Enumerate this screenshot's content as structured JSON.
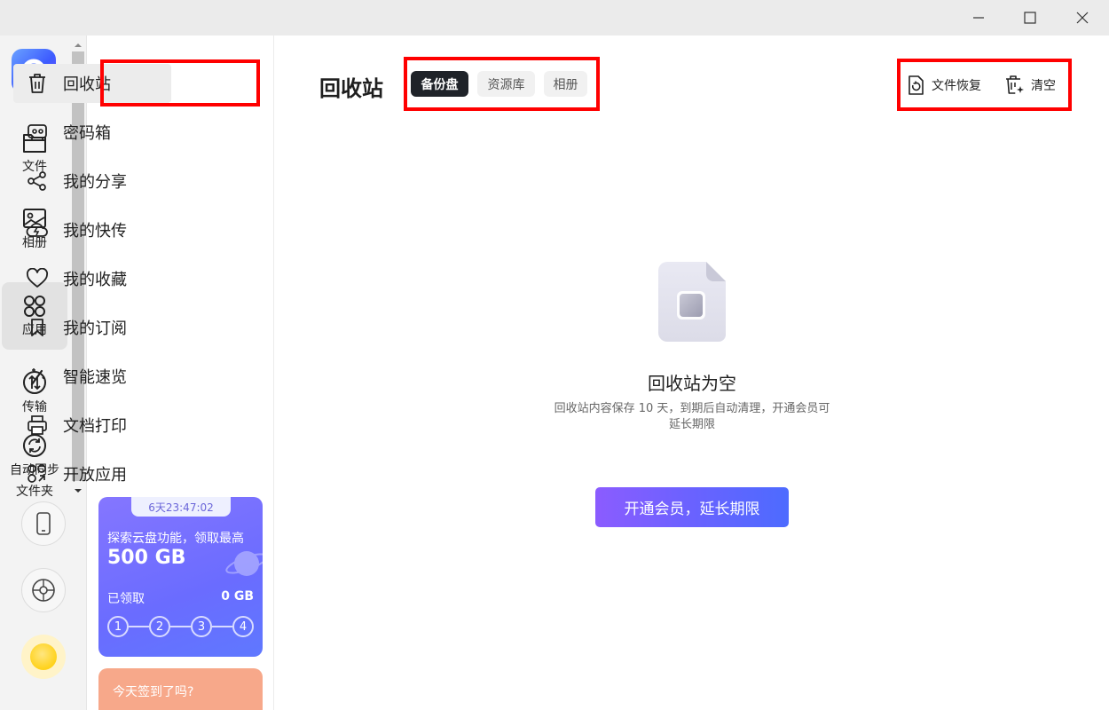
{
  "window": {
    "controls": [
      "minimize",
      "maximize",
      "close"
    ]
  },
  "rail": {
    "items": [
      {
        "label": "文件",
        "icon": "folder-icon"
      },
      {
        "label": "相册",
        "icon": "photo-icon"
      },
      {
        "label": "应用",
        "icon": "apps-icon",
        "active": true
      },
      {
        "label": "传输",
        "icon": "transfer-icon"
      },
      {
        "label": "自动同步",
        "label2": "文件夹",
        "icon": "sync-icon"
      }
    ],
    "bottom": [
      "phone-icon",
      "settings-icon",
      "avatar"
    ]
  },
  "nav": {
    "items": [
      {
        "label": "回收站",
        "icon": "trash-icon",
        "active": true
      },
      {
        "label": "密码箱",
        "icon": "safe-icon"
      },
      {
        "label": "我的分享",
        "icon": "share-icon"
      },
      {
        "label": "我的快传",
        "icon": "cloud-bolt-icon"
      },
      {
        "label": "我的收藏",
        "icon": "heart-icon"
      },
      {
        "label": "我的订阅",
        "icon": "bookmark-icon"
      },
      {
        "label": "智能速览",
        "icon": "magic-wand-icon"
      },
      {
        "label": "文档打印",
        "icon": "printer-icon"
      },
      {
        "label": "开放应用",
        "icon": "open-apps-icon"
      }
    ]
  },
  "promo": {
    "timer": "6天23:47:02",
    "line1": "探索云盘功能，领取最高",
    "amount": "500 GB",
    "claimed_label": "已领取",
    "claimed_value": "0 GB",
    "steps": [
      "1",
      "2",
      "3",
      "4"
    ]
  },
  "checkin": {
    "text": "今天签到了吗?"
  },
  "main": {
    "title": "回收站",
    "tabs": [
      {
        "label": "备份盘",
        "active": true
      },
      {
        "label": "资源库",
        "active": false
      },
      {
        "label": "相册",
        "active": false
      }
    ],
    "actions": [
      {
        "label": "文件恢复",
        "icon": "restore-file-icon"
      },
      {
        "label": "清空",
        "icon": "clear-trash-icon"
      }
    ],
    "empty": {
      "title": "回收站为空",
      "desc_line1": "回收站内容保存 10 天，到期后自动清理，开通会员可",
      "desc_line2": "延长期限",
      "cta": "开通会员，延长期限"
    }
  },
  "colors": {
    "highlight_box": "#ff0000",
    "tab_active_bg": "#1f2329",
    "cta_gradient_start": "#8b5cff",
    "cta_gradient_end": "#4d6bff",
    "promo_bg": "#6a6cff",
    "checkin_bg": "#f7a88a"
  }
}
